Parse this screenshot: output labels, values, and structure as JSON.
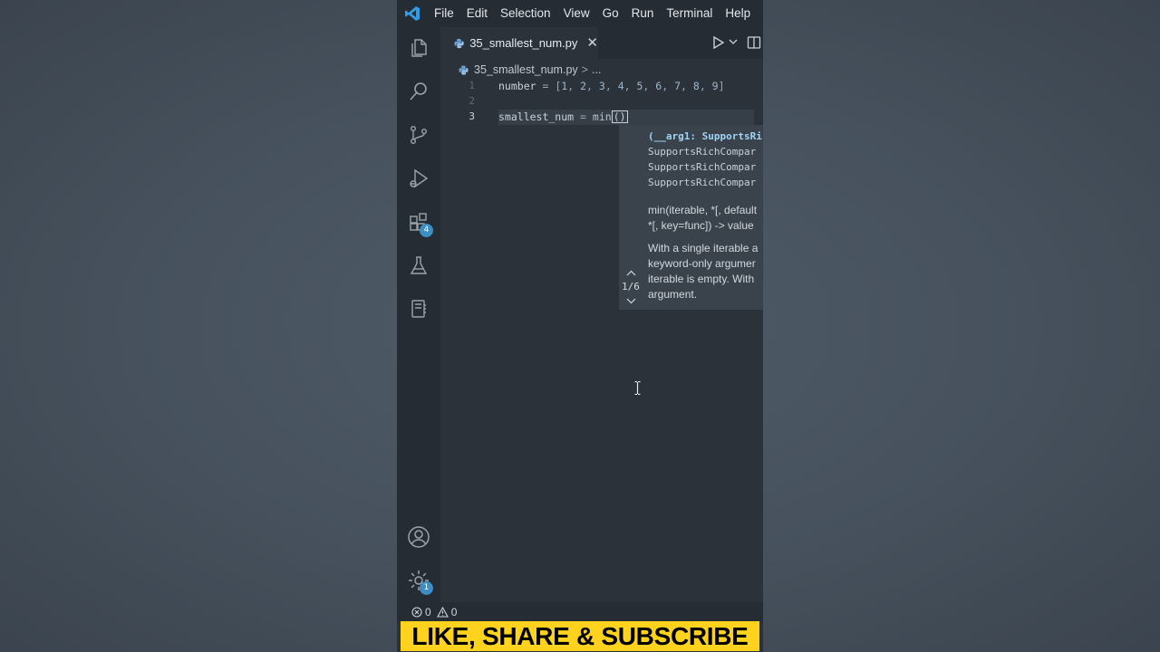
{
  "menubar": {
    "items": [
      "File",
      "Edit",
      "Selection",
      "View",
      "Go",
      "Run",
      "Terminal",
      "Help"
    ],
    "logo_icon": "vscode-logo-icon"
  },
  "activitybar": {
    "items": [
      {
        "name": "explorer",
        "icon": "files-icon"
      },
      {
        "name": "search",
        "icon": "search-icon"
      },
      {
        "name": "source-control",
        "icon": "source-control-icon"
      },
      {
        "name": "run-debug",
        "icon": "run-debug-icon"
      },
      {
        "name": "extensions",
        "icon": "extensions-icon",
        "badge": "4"
      },
      {
        "name": "testing",
        "icon": "flask-icon"
      },
      {
        "name": "notebook",
        "icon": "notebook-icon"
      }
    ],
    "bottom": [
      {
        "name": "accounts",
        "icon": "account-icon"
      },
      {
        "name": "manage",
        "icon": "gear-icon",
        "badge": "1"
      }
    ]
  },
  "tab": {
    "label": "35_smallest_num.py"
  },
  "breadcrumb": {
    "file": "35_smallest_num.py",
    "sep": ">",
    "more": "..."
  },
  "editor": {
    "lines": [
      {
        "num": "1",
        "text": "number = [1, 2, 3, 4, 5, 6, 7, 8, 9]"
      },
      {
        "num": "2",
        "text": ""
      },
      {
        "num": "3",
        "text": "smallest_num = min()"
      }
    ],
    "line1": {
      "var": "number",
      "op": "=",
      "open": "[",
      "close": "]",
      "nums": [
        "1",
        "2",
        "3",
        "4",
        "5",
        "6",
        "7",
        "8",
        "9"
      ]
    },
    "line3": {
      "var": "smallest_num",
      "op": "=",
      "fn": "min",
      "parens": "()"
    }
  },
  "hover": {
    "signature_bold": "(__arg1: SupportsRi",
    "signature_lines": [
      "SupportsRichCompar",
      "SupportsRichCompar",
      "SupportsRichCompar"
    ],
    "doc_sig": [
      "min(iterable, *[, default",
      "*[, key=func]) -> value"
    ],
    "doc_text": [
      "With a single iterable a",
      "keyword-only argumer",
      "iterable is empty. With",
      "argument."
    ],
    "pager": "1/6"
  },
  "status": {
    "errors": "0",
    "warnings": "0"
  },
  "banner": {
    "text": "LIKE, SHARE & SUBSCRIBE"
  },
  "colors": {
    "accent": "#3d8ec4",
    "banner": "#ffd21e",
    "editor_bg": "#2b323a"
  }
}
